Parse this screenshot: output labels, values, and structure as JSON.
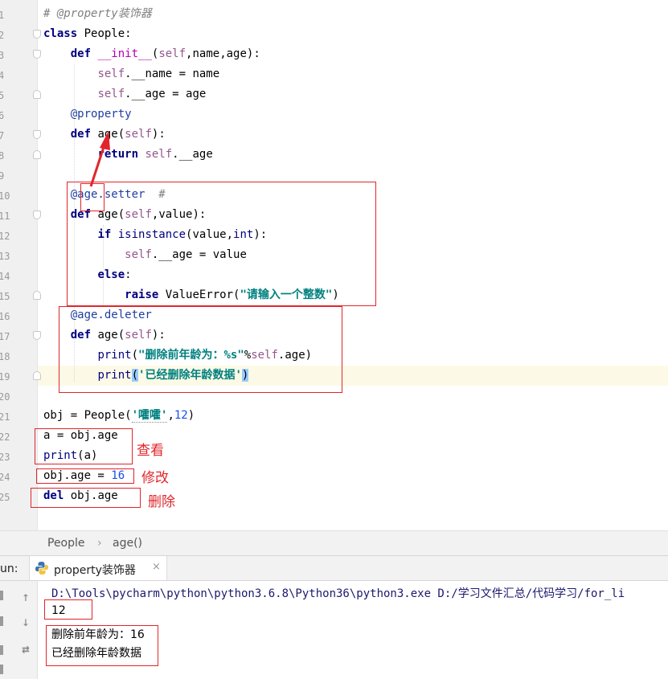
{
  "editor": {
    "line_numbers": [
      "1",
      "2",
      "3",
      "4",
      "5",
      "6",
      "7",
      "8",
      "9",
      "10",
      "11",
      "12",
      "13",
      "14",
      "15",
      "16",
      "17",
      "18",
      "19",
      "20",
      "21",
      "22",
      "23",
      "24",
      "25"
    ],
    "lines": {
      "l1_comment": "# @property装饰器",
      "l2_kw": "class",
      "l2_rest": " People:",
      "l3_kw": "def",
      "l3_fn": "__init__",
      "l3_open": "(",
      "l3_self": "self",
      "l3_rest": ",name,age):",
      "l4_self": "self",
      "l4_rest": ".__name = name",
      "l5_self": "self",
      "l5_rest": ".__age = age",
      "l6_deco": "@property",
      "l7_kw": "def",
      "l7_rest": " age(",
      "l7_self": "self",
      "l7_close": "):",
      "l8_kw": "return",
      "l8_self": "self",
      "l8_rest": ".__age",
      "l10_deco": "@age.setter",
      "l10_comment": "  #",
      "l11_kw": "def",
      "l11_rest": " age(",
      "l11_self": "self",
      "l11_close": ",value):",
      "l12_kw": "if",
      "l12_fn": "isinstance",
      "l12_rest": "(value,",
      "l12_int": "int",
      "l12_close": "):",
      "l13_self": "self",
      "l13_rest": ".__age = value",
      "l14_kw": "else",
      "l14_rest": ":",
      "l15_kw": "raise",
      "l15_rest": " ValueError(",
      "l15_str": "\"请输入一个整数\"",
      "l15_close": ")",
      "l16_deco": "@age.deleter",
      "l17_kw": "def",
      "l17_rest": " age(",
      "l17_self": "self",
      "l17_close": "):",
      "l18_fn": "print",
      "l18_open": "(",
      "l18_str": "\"删除前年龄为：%s\"",
      "l18_pct": "%",
      "l18_self": "self",
      "l18_rest": ".age)",
      "l19_fn": "print",
      "l19_open": "(",
      "l19_str": "'已经删除年龄数据'",
      "l19_close": ")",
      "l21_a": "obj = People(",
      "l21_str": "'嚯嚯'",
      "l21_comma": ",",
      "l21_num": "12",
      "l21_close": ")",
      "l22": "a = obj.age",
      "l23_fn": "print",
      "l23_rest": "(a)",
      "l24_a": "obj.age = ",
      "l24_num": "16",
      "l25_kw": "del",
      "l25_rest": " obj.age"
    },
    "annotations": {
      "view": "查看",
      "modify": "修改",
      "delete": "删除"
    },
    "annotation_color": "#e0262b",
    "current_line_color": "#fcfae6"
  },
  "breadcrumb": {
    "class_name": "People",
    "separator": "›",
    "method_name": "age()"
  },
  "run": {
    "label": "un:",
    "tab_label": "property装饰器",
    "tab_close": "×",
    "toolbar_icons": [
      "up-arrow-icon",
      "down-arrow-icon",
      "soft-wrap-icon"
    ],
    "console": {
      "command": "D:\\Tools\\pycharm\\python\\python3.6.8\\Python36\\python3.exe D:/学习文件汇总/代码学习/for_li",
      "out1": "12",
      "out2": "删除前年龄为：16",
      "out3": "已经删除年龄数据"
    }
  }
}
